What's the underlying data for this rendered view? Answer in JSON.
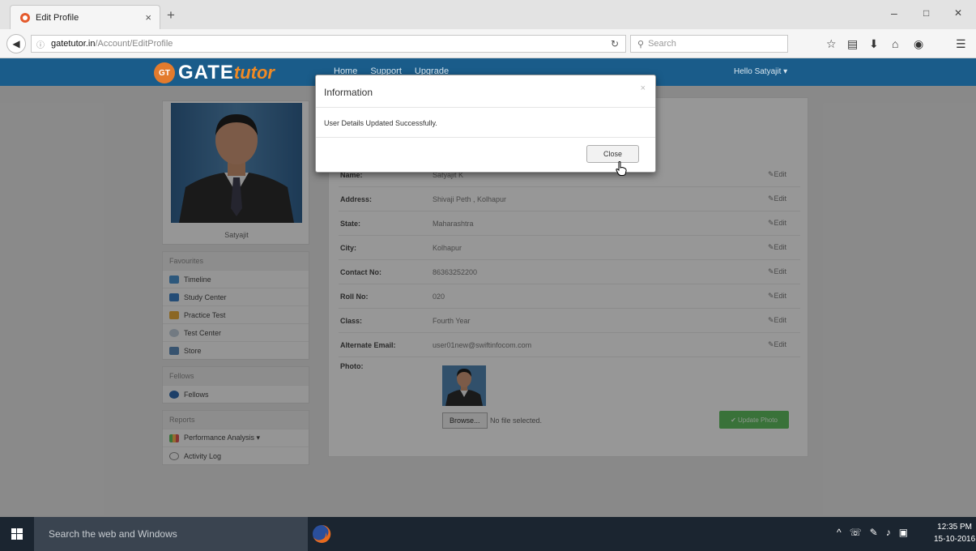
{
  "browser": {
    "tab_title": "Edit Profile",
    "tab_close": "×",
    "new_tab": "+",
    "url_host": "gatetutor.in",
    "url_path": "/Account/EditProfile",
    "search_placeholder": "Search",
    "minimize": "–",
    "maximize": "□",
    "close": "✕"
  },
  "site": {
    "logo_a": "GATE",
    "logo_b": "tutor",
    "logo_badge": "GT",
    "nav": [
      "Home",
      "Support",
      "Upgrade"
    ],
    "greeting": "Hello Satyajit ▾"
  },
  "sidebar": {
    "profile_name": "Satyajit",
    "favourites_head": "Favourites",
    "favourites": [
      "Timeline",
      "Study Center",
      "Practice Test",
      "Test Center",
      "Store"
    ],
    "fellows_head": "Fellows",
    "fellows": [
      "Fellows"
    ],
    "reports_head": "Reports",
    "reports": [
      "Performance Analysis ▾",
      "Activity Log"
    ]
  },
  "profile": {
    "rows": [
      {
        "label": "Name:",
        "value": "Satyajit K",
        "edit": "✎Edit"
      },
      {
        "label": "Address:",
        "value": "Shivaji Peth , Kolhapur",
        "edit": "✎Edit"
      },
      {
        "label": "State:",
        "value": "Maharashtra",
        "edit": "✎Edit"
      },
      {
        "label": "City:",
        "value": "Kolhapur",
        "edit": "✎Edit"
      },
      {
        "label": "Contact No:",
        "value": "86363252200",
        "edit": "✎Edit"
      },
      {
        "label": "Roll No:",
        "value": "020",
        "edit": "✎Edit"
      },
      {
        "label": "Class:",
        "value": "Fourth Year",
        "edit": "✎Edit"
      },
      {
        "label": "Alternate Email:",
        "value": "user01new@swiftinfocom.com",
        "edit": "✎Edit"
      }
    ],
    "photo_label": "Photo:",
    "browse": "Browse...",
    "no_file": "No file selected.",
    "upload": "✔ Update Photo"
  },
  "modal": {
    "title": "Information",
    "close_x": "×",
    "message": "User Details Updated Successfully.",
    "close_button": "Close"
  },
  "taskbar": {
    "search_placeholder": "Search the web and Windows",
    "time": "12:35 PM",
    "date": "15-10-2016"
  }
}
